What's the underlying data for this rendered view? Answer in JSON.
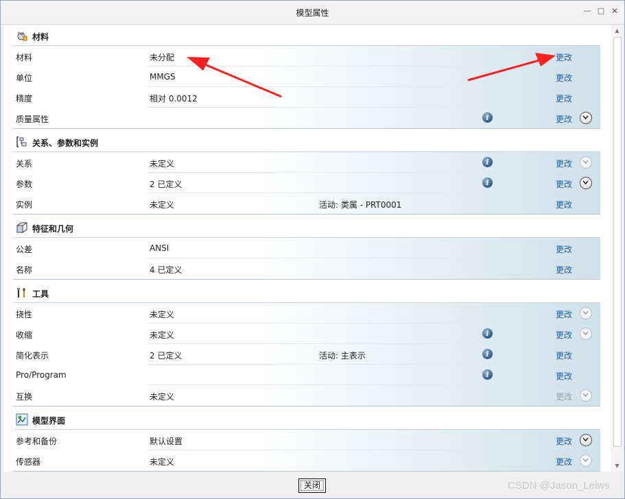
{
  "window": {
    "title": "模型属性",
    "close_button": "关闭"
  },
  "watermark": "CSDN @Jason_Leiws",
  "annotation_color": "#ff2020",
  "sections": [
    {
      "title": "材料",
      "icon": "material-icon",
      "rows": [
        {
          "label": "材料",
          "value": "未分配",
          "change": "更改"
        },
        {
          "label": "单位",
          "value": "MMGS",
          "change": "更改"
        },
        {
          "label": "精度",
          "value": "相对 0.0012",
          "change": "更改"
        },
        {
          "label": "质量属性",
          "value": "",
          "change": "更改"
        }
      ]
    },
    {
      "title": "关系、参数和实例",
      "icon": "relations-icon",
      "rows": [
        {
          "label": "关系",
          "value": "未定义",
          "change": "更改"
        },
        {
          "label": "参数",
          "value": "2 已定义",
          "change": "更改"
        },
        {
          "label": "实例",
          "value": "未定义",
          "extra": "活动: 类属 - PRT0001",
          "change": "更改"
        }
      ]
    },
    {
      "title": "特征和几何",
      "icon": "features-icon",
      "rows": [
        {
          "label": "公差",
          "value": "ANSI",
          "change": "更改"
        },
        {
          "label": "名称",
          "value": "4 已定义",
          "change": "更改"
        }
      ]
    },
    {
      "title": "工具",
      "icon": "tools-icon",
      "rows": [
        {
          "label": "挠性",
          "value": "未定义",
          "change": "更改"
        },
        {
          "label": "收缩",
          "value": "未定义",
          "change": "更改"
        },
        {
          "label": "简化表示",
          "value": "2 已定义",
          "extra": "活动: 主表示",
          "change": "更改"
        },
        {
          "label": "Pro/Program",
          "value": "",
          "change": "更改"
        },
        {
          "label": "互换",
          "value": "未定义",
          "change": "更改"
        }
      ]
    },
    {
      "title": "模型界面",
      "icon": "model-interface-icon",
      "rows": [
        {
          "label": "参考和备份",
          "value": "默认设置",
          "change": "更改"
        },
        {
          "label": "传感器",
          "value": "未定义",
          "change": "更改"
        }
      ]
    }
  ]
}
